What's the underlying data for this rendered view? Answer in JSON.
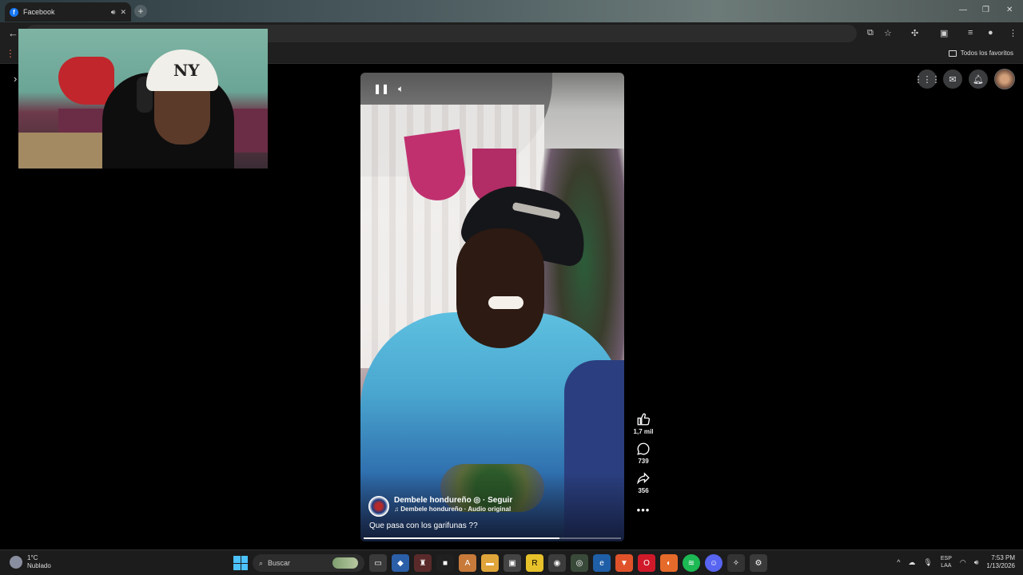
{
  "browser": {
    "tab_title": "Facebook",
    "bookmarks_folder": "Todos los favoritos"
  },
  "reel": {
    "author_name": "Dembele hondureño",
    "follow_label": "Seguir",
    "audio_label": "Dembele hondureño · Audio original",
    "caption": "Que pasa con los garifunas ??",
    "progress_percent": 76
  },
  "actions": {
    "likes": "1,7 mil",
    "comments": "739",
    "shares": "356"
  },
  "webcam": {
    "cap_logo": "NY"
  },
  "taskbar": {
    "temperature": "1°C",
    "weather_desc": "Nublado",
    "search_placeholder": "Buscar",
    "lang_line1": "ESP",
    "lang_line2": "LAA",
    "time": "7:53 PM",
    "date": "1/13/2026"
  },
  "colors": {
    "fb_blue": "#1877f2",
    "windows_blue": "#4cc2ff",
    "background": "#000000"
  }
}
